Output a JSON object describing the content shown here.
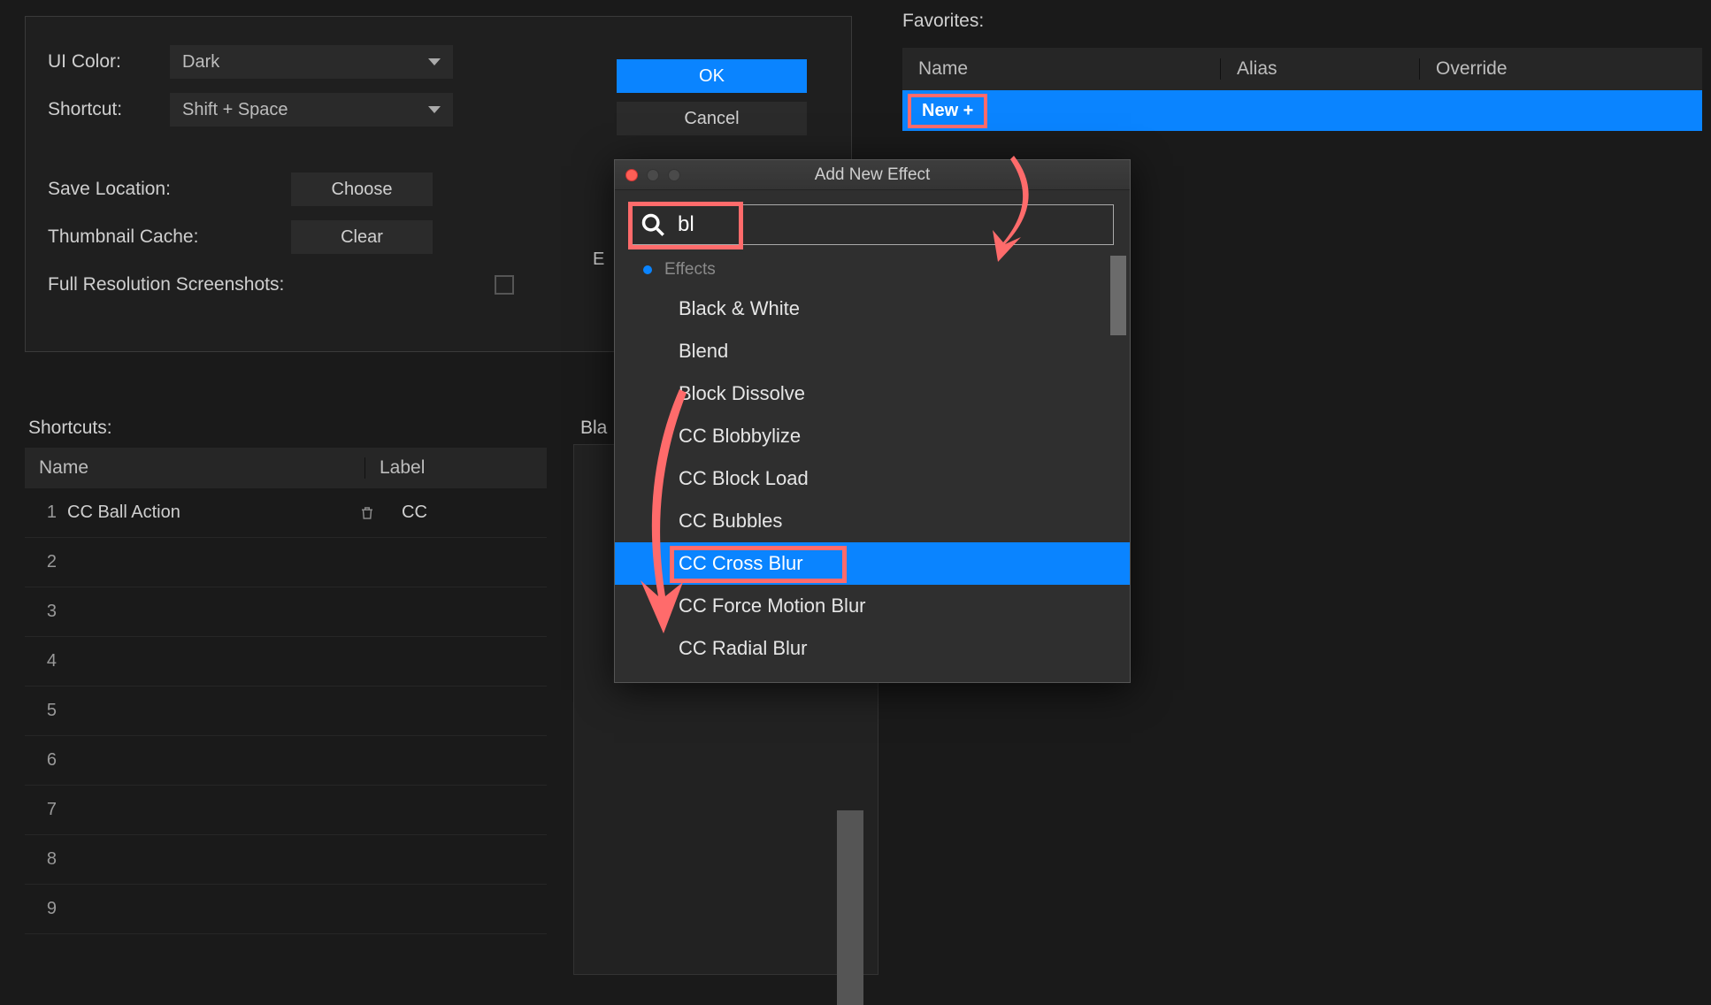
{
  "settings": {
    "ui_color_label": "UI Color:",
    "ui_color_value": "Dark",
    "shortcut_label": "Shortcut:",
    "shortcut_value": "Shift + Space",
    "save_location_label": "Save Location:",
    "choose_btn": "Choose",
    "thumbnail_cache_label": "Thumbnail Cache:",
    "clear_btn": "Clear",
    "full_res_label": "Full Resolution Screenshots:",
    "ok_btn": "OK",
    "cancel_btn": "Cancel"
  },
  "favorites": {
    "title": "Favorites:",
    "col_name": "Name",
    "col_alias": "Alias",
    "col_override": "Override",
    "new_btn": "New +"
  },
  "shortcuts": {
    "title": "Shortcuts:",
    "fragment": "Bla",
    "col_name": "Name",
    "col_label": "Label",
    "rows": [
      {
        "num": "1",
        "name": "CC Ball Action",
        "label": "CC"
      },
      {
        "num": "2",
        "name": "",
        "label": ""
      },
      {
        "num": "3",
        "name": "",
        "label": ""
      },
      {
        "num": "4",
        "name": "",
        "label": ""
      },
      {
        "num": "5",
        "name": "",
        "label": ""
      },
      {
        "num": "6",
        "name": "",
        "label": ""
      },
      {
        "num": "7",
        "name": "",
        "label": ""
      },
      {
        "num": "8",
        "name": "",
        "label": ""
      },
      {
        "num": "9",
        "name": "",
        "label": ""
      }
    ]
  },
  "dialog": {
    "title": "Add New Effect",
    "search_value": "bl",
    "category": "Effects",
    "items": [
      "Black & White",
      "Blend",
      "Block Dissolve",
      "CC Blobbylize",
      "CC Block Load",
      "CC Bubbles",
      "CC Cross Blur",
      "CC Force Motion Blur",
      "CC Radial Blur"
    ],
    "selected_index": 6
  },
  "fragments": {
    "e": "E"
  }
}
